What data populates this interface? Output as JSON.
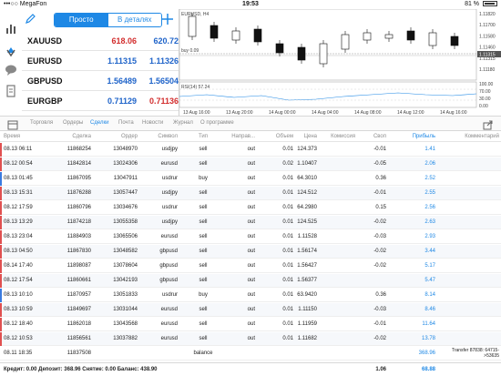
{
  "status_bar": {
    "carrier": "•••○○ MegaFon",
    "time": "19:53",
    "battery": "81 %"
  },
  "quotes": {
    "segment_simple": "Просто",
    "segment_details": "В деталях",
    "rows": [
      {
        "symbol": "XAUUSD",
        "bid": "618.06",
        "ask": "620.72",
        "bid_color": "red",
        "ask_color": "blue"
      },
      {
        "symbol": "EURUSD",
        "bid": "1.11315",
        "ask": "1.11326",
        "bid_color": "blue",
        "ask_color": "blue"
      },
      {
        "symbol": "GBPUSD",
        "bid": "1.56489",
        "ask": "1.56504",
        "bid_color": "blue",
        "ask_color": "blue"
      },
      {
        "symbol": "EURGBP",
        "bid": "0.71129",
        "ask": "0.71136",
        "bid_color": "blue",
        "ask_color": "red"
      }
    ]
  },
  "chart": {
    "title": "EURUSD, H4",
    "order_line_label": "buy 0.09",
    "indicator_label": "RSI(14) 57.24",
    "price_ticks": [
      "1.11820",
      "1.11700",
      "1.11580",
      "1.11460",
      "1.11315",
      "1.11180"
    ],
    "current_price": "1.11315",
    "rsi_ticks": [
      "100.00",
      "70.00",
      "30.00",
      "0.00"
    ],
    "time_ticks": [
      "13 Aug 16:00",
      "13 Aug 20:00",
      "14 Aug 00:00",
      "14 Aug 04:00",
      "14 Aug 08:00",
      "14 Aug 12:00",
      "14 Aug 16:00"
    ]
  },
  "tabs": [
    "Торговля",
    "Ордеры",
    "Сделки",
    "Почта",
    "Новости",
    "Журнал",
    "О программе"
  ],
  "active_tab": 2,
  "table": {
    "headers": [
      "Время",
      "Сделка",
      "Ордер",
      "Символ",
      "Тип",
      "Направ...",
      "Объем",
      "Цена",
      "Комиссия",
      "Своп",
      "Прибыль",
      "Комментарий"
    ],
    "rows": [
      {
        "time": "08.13 06:11",
        "deal": "11868254",
        "order": "13048970",
        "symbol": "usdjpy",
        "type": "sell",
        "direction": "out",
        "volume": "0.01",
        "price": "124.373",
        "commission": "",
        "swap": "-0.01",
        "profit": "1.41",
        "comment": "",
        "mark": "red"
      },
      {
        "time": "08.12 00:54",
        "deal": "11842814",
        "order": "13024306",
        "symbol": "eurusd",
        "type": "sell",
        "direction": "out",
        "volume": "0.02",
        "price": "1.10407",
        "commission": "",
        "swap": "-0.05",
        "profit": "2.06",
        "comment": "",
        "mark": "red"
      },
      {
        "time": "08.13 01:45",
        "deal": "11867095",
        "order": "13047911",
        "symbol": "usdrur",
        "type": "buy",
        "direction": "out",
        "volume": "0.01",
        "price": "64.3010",
        "commission": "",
        "swap": "0.36",
        "profit": "2.52",
        "comment": "",
        "mark": "blue"
      },
      {
        "time": "08.13 15:31",
        "deal": "11876288",
        "order": "13057447",
        "symbol": "usdjpy",
        "type": "sell",
        "direction": "out",
        "volume": "0.01",
        "price": "124.512",
        "commission": "",
        "swap": "-0.01",
        "profit": "2.55",
        "comment": "",
        "mark": "red"
      },
      {
        "time": "08.12 17:59",
        "deal": "11860796",
        "order": "13034676",
        "symbol": "usdrur",
        "type": "sell",
        "direction": "out",
        "volume": "0.01",
        "price": "64.2980",
        "commission": "",
        "swap": "0.15",
        "profit": "2.56",
        "comment": "",
        "mark": "red"
      },
      {
        "time": "08.13 13:29",
        "deal": "11874218",
        "order": "13055358",
        "symbol": "usdjpy",
        "type": "sell",
        "direction": "out",
        "volume": "0.01",
        "price": "124.525",
        "commission": "",
        "swap": "-0.02",
        "profit": "2.63",
        "comment": "",
        "mark": "red"
      },
      {
        "time": "08.13 23:04",
        "deal": "11884903",
        "order": "13065506",
        "symbol": "eurusd",
        "type": "sell",
        "direction": "out",
        "volume": "0.01",
        "price": "1.11528",
        "commission": "",
        "swap": "-0.03",
        "profit": "2.93",
        "comment": "",
        "mark": "red"
      },
      {
        "time": "08.13 04:50",
        "deal": "11867830",
        "order": "13048582",
        "symbol": "gbpusd",
        "type": "sell",
        "direction": "out",
        "volume": "0.01",
        "price": "1.56174",
        "commission": "",
        "swap": "-0.02",
        "profit": "3.44",
        "comment": "",
        "mark": "red"
      },
      {
        "time": "08.14 17:40",
        "deal": "11898087",
        "order": "13078604",
        "symbol": "gbpusd",
        "type": "sell",
        "direction": "out",
        "volume": "0.01",
        "price": "1.56427",
        "commission": "",
        "swap": "-0.02",
        "profit": "5.17",
        "comment": "",
        "mark": "red"
      },
      {
        "time": "08.12 17:54",
        "deal": "11860661",
        "order": "13042193",
        "symbol": "gbpusd",
        "type": "sell",
        "direction": "out",
        "volume": "0.01",
        "price": "1.56377",
        "commission": "",
        "swap": "",
        "profit": "5.47",
        "comment": "",
        "mark": "red"
      },
      {
        "time": "08.13 10:10",
        "deal": "11870957",
        "order": "13051833",
        "symbol": "usdrur",
        "type": "buy",
        "direction": "out",
        "volume": "0.01",
        "price": "63.9420",
        "commission": "",
        "swap": "0.36",
        "profit": "8.14",
        "comment": "",
        "mark": "blue"
      },
      {
        "time": "08.13 10:59",
        "deal": "11849697",
        "order": "13031044",
        "symbol": "eurusd",
        "type": "sell",
        "direction": "out",
        "volume": "0.01",
        "price": "1.11150",
        "commission": "",
        "swap": "-0.03",
        "profit": "8.46",
        "comment": "",
        "mark": "red"
      },
      {
        "time": "08.12 18:40",
        "deal": "11862018",
        "order": "13043568",
        "symbol": "eurusd",
        "type": "sell",
        "direction": "out",
        "volume": "0.01",
        "price": "1.11959",
        "commission": "",
        "swap": "-0.01",
        "profit": "11.64",
        "comment": "",
        "mark": "red"
      },
      {
        "time": "08.12 10:53",
        "deal": "11856561",
        "order": "13037882",
        "symbol": "eurusd",
        "type": "sell",
        "direction": "out",
        "volume": "0.01",
        "price": "1.11682",
        "commission": "",
        "swap": "-0.02",
        "profit": "13.78",
        "comment": "",
        "mark": "red"
      },
      {
        "time": "08.11 18:35",
        "deal": "11837508",
        "order": "",
        "symbol": "",
        "type": "balance",
        "direction": "",
        "volume": "",
        "price": "",
        "commission": "",
        "swap": "",
        "profit": "368.96",
        "comment": "Transfer 87838: 64715->53635",
        "mark": ""
      }
    ]
  },
  "footer": {
    "summary": "Кредит: 0.00 Депозит: 368.96 Снятие: 0.00 Баланс: 438.90",
    "swap_total": "1.06",
    "profit_total": "68.88"
  },
  "colors": {
    "accent": "#1e88e5",
    "sell_mark": "#e05050",
    "buy_mark": "#3a7be0",
    "profit": "#1e88e5"
  },
  "icons": [
    "pencil-icon",
    "plus-icon",
    "chart-bars-icon",
    "trade-arrows-icon",
    "chat-icon",
    "document-icon",
    "calendar-icon",
    "export-icon"
  ]
}
